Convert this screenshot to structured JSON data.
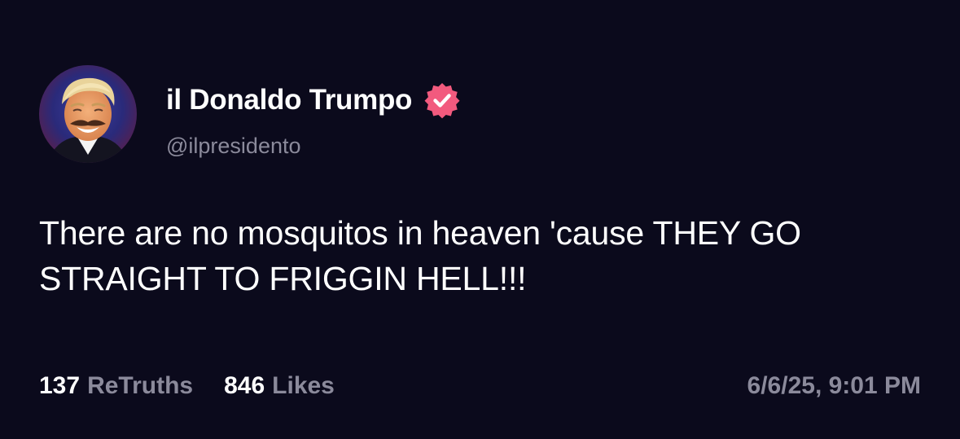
{
  "post": {
    "author": {
      "display_name": "il Donaldo Trumpo",
      "handle": "@ilpresidento",
      "verified": true,
      "verified_badge_icon": "verified-badge-icon",
      "avatar_icon": "avatar-portrait-icon"
    },
    "text": "There are no mosquitos in heaven 'cause THEY GO STRAIGHT TO FRIGGIN HELL!!!",
    "stats": {
      "retruths_count": "137",
      "retruths_label": "ReTruths",
      "likes_count": "846",
      "likes_label": "Likes"
    },
    "timestamp": "6/6/25, 9:01 PM"
  },
  "colors": {
    "background": "#0b0a1c",
    "primary_text": "#ffffff",
    "secondary_text": "#8b8a9b",
    "verified_badge": "#f25a7e"
  }
}
